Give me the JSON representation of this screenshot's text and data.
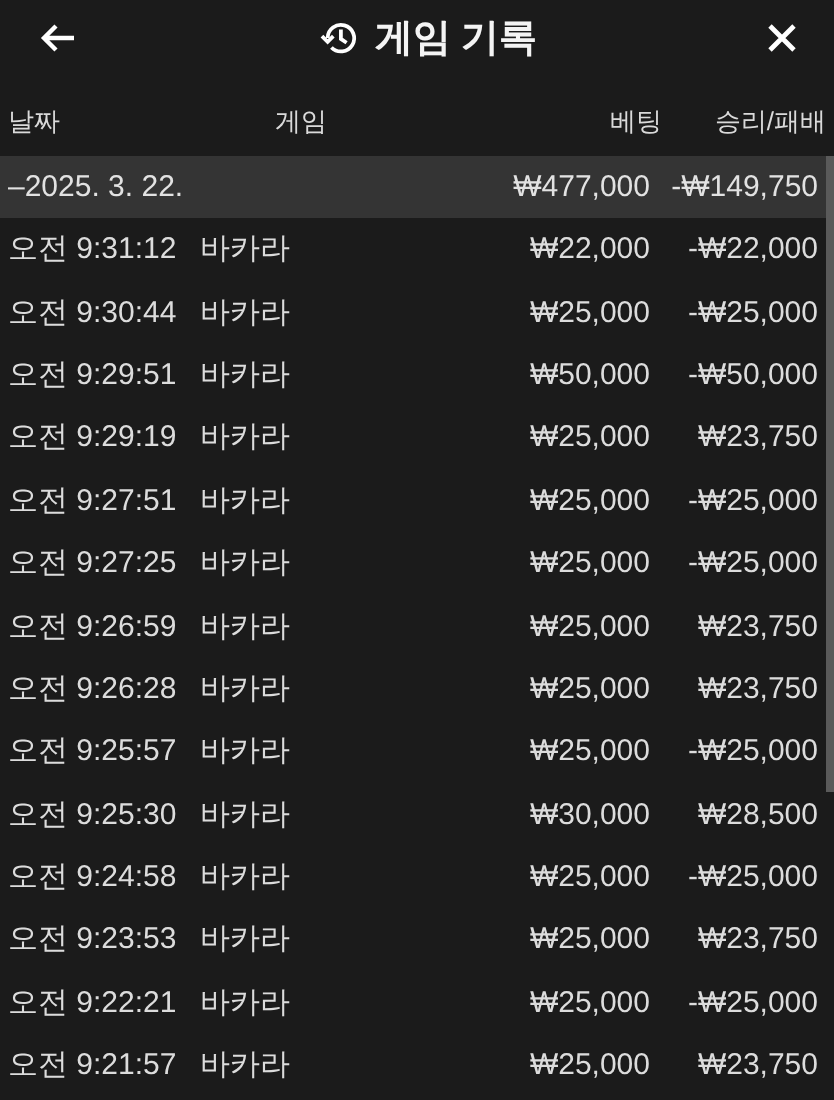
{
  "header": {
    "title": "게임 기록"
  },
  "columns": [
    "날짜",
    "게임",
    "베팅",
    "승리/패배"
  ],
  "group": {
    "toggle": "–",
    "date": "2025. 3. 22.",
    "bet": "₩477,000",
    "result": "-₩149,750",
    "expanded": true
  },
  "rows": [
    {
      "time": "오전 9:31:12",
      "game": "바카라",
      "bet": "₩22,000",
      "result": "-₩22,000"
    },
    {
      "time": "오전 9:30:44",
      "game": "바카라",
      "bet": "₩25,000",
      "result": "-₩25,000"
    },
    {
      "time": "오전 9:29:51",
      "game": "바카라",
      "bet": "₩50,000",
      "result": "-₩50,000"
    },
    {
      "time": "오전 9:29:19",
      "game": "바카라",
      "bet": "₩25,000",
      "result": "₩23,750"
    },
    {
      "time": "오전 9:27:51",
      "game": "바카라",
      "bet": "₩25,000",
      "result": "-₩25,000"
    },
    {
      "time": "오전 9:27:25",
      "game": "바카라",
      "bet": "₩25,000",
      "result": "-₩25,000"
    },
    {
      "time": "오전 9:26:59",
      "game": "바카라",
      "bet": "₩25,000",
      "result": "₩23,750"
    },
    {
      "time": "오전 9:26:28",
      "game": "바카라",
      "bet": "₩25,000",
      "result": "₩23,750"
    },
    {
      "time": "오전 9:25:57",
      "game": "바카라",
      "bet": "₩25,000",
      "result": "-₩25,000"
    },
    {
      "time": "오전 9:25:30",
      "game": "바카라",
      "bet": "₩30,000",
      "result": "₩28,500"
    },
    {
      "time": "오전 9:24:58",
      "game": "바카라",
      "bet": "₩25,000",
      "result": "-₩25,000"
    },
    {
      "time": "오전 9:23:53",
      "game": "바카라",
      "bet": "₩25,000",
      "result": "₩23,750"
    },
    {
      "time": "오전 9:22:21",
      "game": "바카라",
      "bet": "₩25,000",
      "result": "-₩25,000"
    },
    {
      "time": "오전 9:21:57",
      "game": "바카라",
      "bet": "₩25,000",
      "result": "₩23,750"
    }
  ]
}
